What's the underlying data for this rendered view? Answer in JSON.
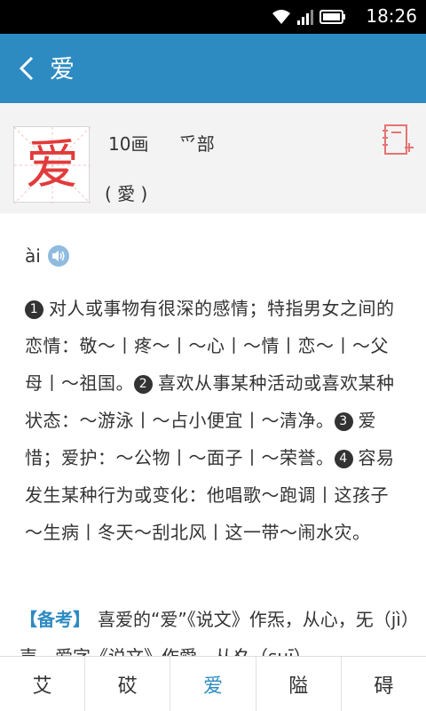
{
  "status_bar": {
    "time": "18:26"
  },
  "app_bar": {
    "title": "爱"
  },
  "header": {
    "character": "爱",
    "strokes": "10画",
    "radical": "爫部",
    "traditional": "( 愛 )"
  },
  "content": {
    "pinyin": "ài",
    "definitions": [
      {
        "num": "1",
        "text": "对人或事物有很深的感情；特指男女之间的恋情：敬～丨疼～丨～心丨～情丨恋～丨～父母丨～祖国。"
      },
      {
        "num": "2",
        "text": "喜欢从事某种活动或喜欢某种状态：～游泳丨～占小便宜丨～清净。"
      },
      {
        "num": "3",
        "text": "爱惜；爱护：～公物丨～面子丨～荣誉。"
      },
      {
        "num": "4",
        "text": "容易发生某种行为或变化：他唱歌～跑调丨这孩子～生病丨冬天～刮北风丨这一带～闹水灾。"
      }
    ],
    "note_label": "【备考】",
    "note_text": "喜爱的“爱”《说文》作炁，从心，旡（jì）声。爱字《说文》作愛，从夊（suī）"
  },
  "bottom_tabs": [
    {
      "label": "艾"
    },
    {
      "label": "砹"
    },
    {
      "label": "爱",
      "active": true
    },
    {
      "label": "隘"
    },
    {
      "label": "碍"
    }
  ],
  "colors": {
    "accent": "#2d8bc2",
    "character": "#e23a3a"
  }
}
